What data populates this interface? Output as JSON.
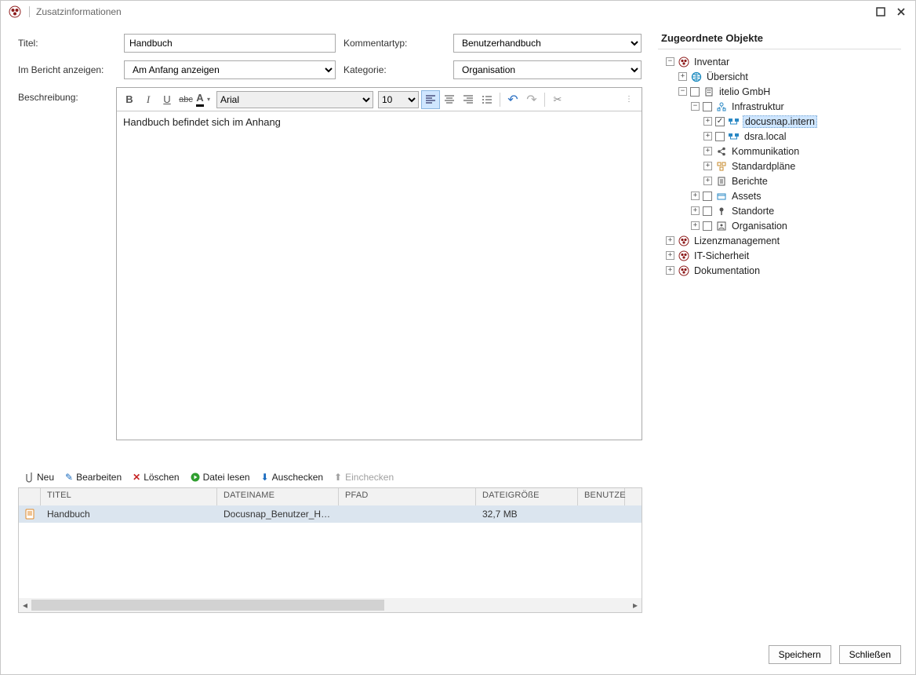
{
  "window": {
    "title": "Zusatzinformationen"
  },
  "form": {
    "title_label": "Titel:",
    "title_value": "Handbuch",
    "report_label": "Im Bericht anzeigen:",
    "report_value": "Am Anfang anzeigen",
    "commenttype_label": "Kommentartyp:",
    "commenttype_value": "Benutzerhandbuch",
    "category_label": "Kategorie:",
    "category_value": "Organisation",
    "description_label": "Beschreibung:"
  },
  "editor": {
    "font_name": "Arial",
    "font_size": "10",
    "body_text": "Handbuch befindet sich im Anhang"
  },
  "attachments": {
    "toolbar": {
      "new": "Neu",
      "edit": "Bearbeiten",
      "delete": "Löschen",
      "read": "Datei lesen",
      "checkout": "Auschecken",
      "checkin": "Einchecken"
    },
    "columns": {
      "title": "TITEL",
      "filename": "DATEINAME",
      "path": "PFAD",
      "filesize": "DATEIGRÖßE",
      "user": "BENUTZE"
    },
    "rows": [
      {
        "title": "Handbuch",
        "filename": "Docusnap_Benutzer_Han...",
        "path": "",
        "filesize": "32,7 MB",
        "user": ""
      }
    ]
  },
  "right": {
    "title": "Zugeordnete Objekte",
    "tree": {
      "inventar": "Inventar",
      "uebersicht": "Übersicht",
      "itelio": "itelio GmbH",
      "infrastruktur": "Infrastruktur",
      "docusnap_intern": "docusnap.intern",
      "dsra_local": "dsra.local",
      "kommunikation": "Kommunikation",
      "standardplaene": "Standardpläne",
      "berichte": "Berichte",
      "assets": "Assets",
      "standorte": "Standorte",
      "organisation": "Organisation",
      "lizenz": "Lizenzmanagement",
      "it_sicherheit": "IT-Sicherheit",
      "dokumentation": "Dokumentation"
    }
  },
  "footer": {
    "save": "Speichern",
    "close": "Schließen"
  }
}
